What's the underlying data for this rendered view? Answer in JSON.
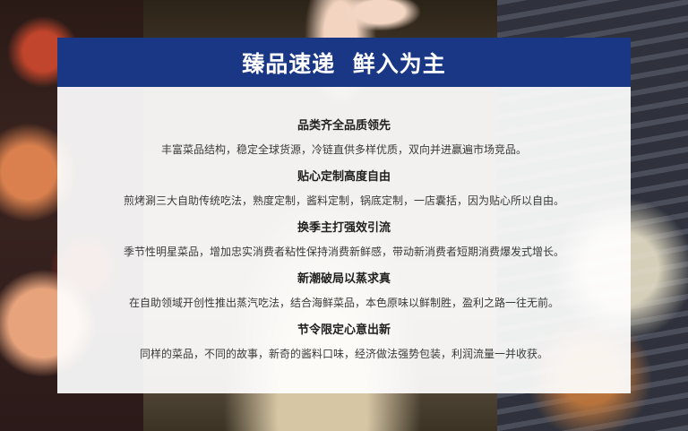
{
  "banner": {
    "title": "臻品速递  鲜入为主"
  },
  "features": [
    {
      "title": "品类齐全品质领先",
      "description": "丰富菜品结构，稳定全球货源，冷链直供多样优质，双向并进赢遍市场竞品。"
    },
    {
      "title": "贴心定制高度自由",
      "description": "煎烤涮三大自助传统吃法，熟度定制，酱料定制，锅底定制，一店囊括，因为贴心所以自由。"
    },
    {
      "title": "换季主打强效引流",
      "description": "季节性明星菜品，增加忠实消费者粘性保持消费新鲜感，带动新消费者短期消费爆发式增长。"
    },
    {
      "title": "新潮破局以蒸求真",
      "description": "在自助领域开创性推出蒸汽吃法，结合海鲜菜品，本色原味以鲜制胜，盈利之路一往无前。"
    },
    {
      "title": "节令限定心意出新",
      "description": "同样的菜品，不同的故事，新奇的酱料口味，经济做法强势包装，利润流量一并收获。"
    }
  ],
  "colors": {
    "header_bg": "#1a3785",
    "body_bg": "#ffffff"
  }
}
